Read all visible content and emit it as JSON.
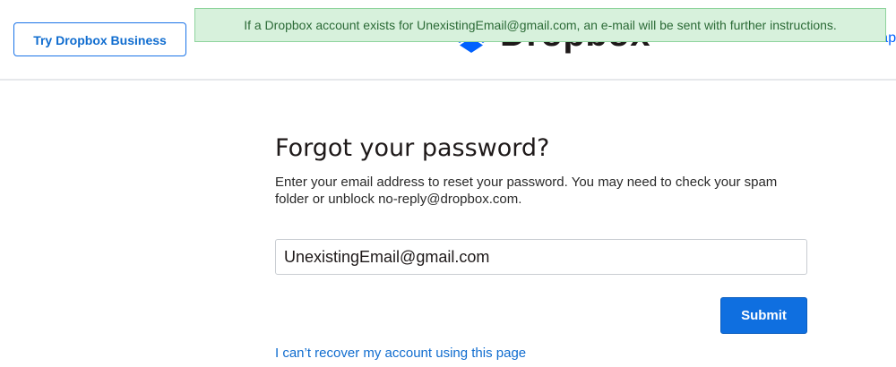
{
  "header": {
    "try_business_label": "Try Dropbox Business",
    "logo_text": "Dropbox",
    "download_label": "Download the app"
  },
  "notice": {
    "message": "If a Dropbox account exists for UnexistingEmail@gmail.com, an e-mail will be sent with further instructions."
  },
  "form": {
    "title": "Forgot your password?",
    "description": "Enter your email address to reset your password. You may need to check your spam folder or unblock no-reply@dropbox.com.",
    "email_value": "UnexistingEmail@gmail.com",
    "submit_label": "Submit",
    "recover_link": "I can’t recover my account using this page"
  },
  "colors": {
    "accent": "#0061fe",
    "notice_bg": "#d7f1dc",
    "notice_text": "#2b6a36"
  },
  "icons": {
    "logo": "dropbox-logo-icon"
  }
}
